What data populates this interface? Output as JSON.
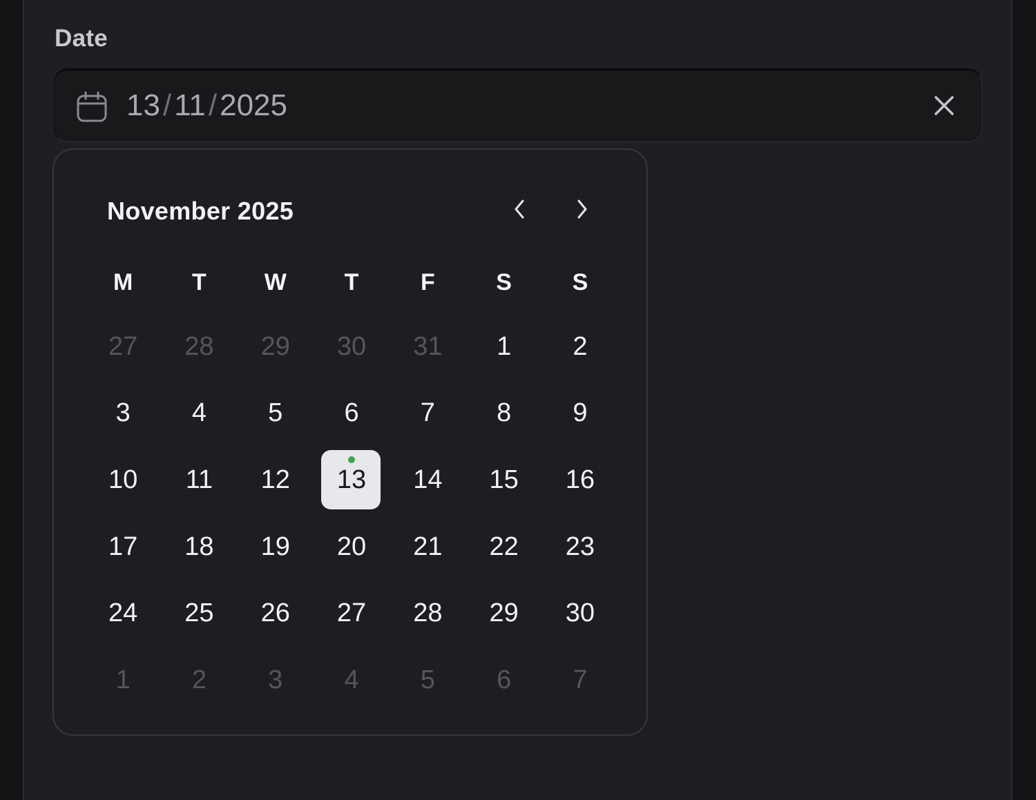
{
  "field": {
    "label": "Date",
    "day": "13",
    "month": "11",
    "year": "2025",
    "separator": "/"
  },
  "icons": {
    "calendar": "calendar-icon",
    "clear": "close-icon",
    "prev": "chevron-left-icon",
    "next": "chevron-right-icon"
  },
  "calendar": {
    "title": "November 2025",
    "weekdays": [
      "M",
      "T",
      "W",
      "T",
      "F",
      "S",
      "S"
    ],
    "weeks": [
      [
        {
          "d": "27",
          "o": true
        },
        {
          "d": "28",
          "o": true
        },
        {
          "d": "29",
          "o": true
        },
        {
          "d": "30",
          "o": true
        },
        {
          "d": "31",
          "o": true
        },
        {
          "d": "1"
        },
        {
          "d": "2"
        }
      ],
      [
        {
          "d": "3"
        },
        {
          "d": "4"
        },
        {
          "d": "5"
        },
        {
          "d": "6"
        },
        {
          "d": "7"
        },
        {
          "d": "8"
        },
        {
          "d": "9"
        }
      ],
      [
        {
          "d": "10"
        },
        {
          "d": "11"
        },
        {
          "d": "12"
        },
        {
          "d": "13",
          "selected": true,
          "today": true
        },
        {
          "d": "14"
        },
        {
          "d": "15"
        },
        {
          "d": "16"
        }
      ],
      [
        {
          "d": "17"
        },
        {
          "d": "18"
        },
        {
          "d": "19"
        },
        {
          "d": "20"
        },
        {
          "d": "21"
        },
        {
          "d": "22"
        },
        {
          "d": "23"
        }
      ],
      [
        {
          "d": "24"
        },
        {
          "d": "25"
        },
        {
          "d": "26"
        },
        {
          "d": "27"
        },
        {
          "d": "28"
        },
        {
          "d": "29"
        },
        {
          "d": "30"
        }
      ],
      [
        {
          "d": "1",
          "o": true
        },
        {
          "d": "2",
          "o": true
        },
        {
          "d": "3",
          "o": true
        },
        {
          "d": "4",
          "o": true
        },
        {
          "d": "5",
          "o": true
        },
        {
          "d": "6",
          "o": true
        },
        {
          "d": "7",
          "o": true
        }
      ]
    ]
  },
  "colors": {
    "selected_bg": "#e8e8ec",
    "today_dot": "#3fa64a",
    "outside_text": "#55555b"
  }
}
